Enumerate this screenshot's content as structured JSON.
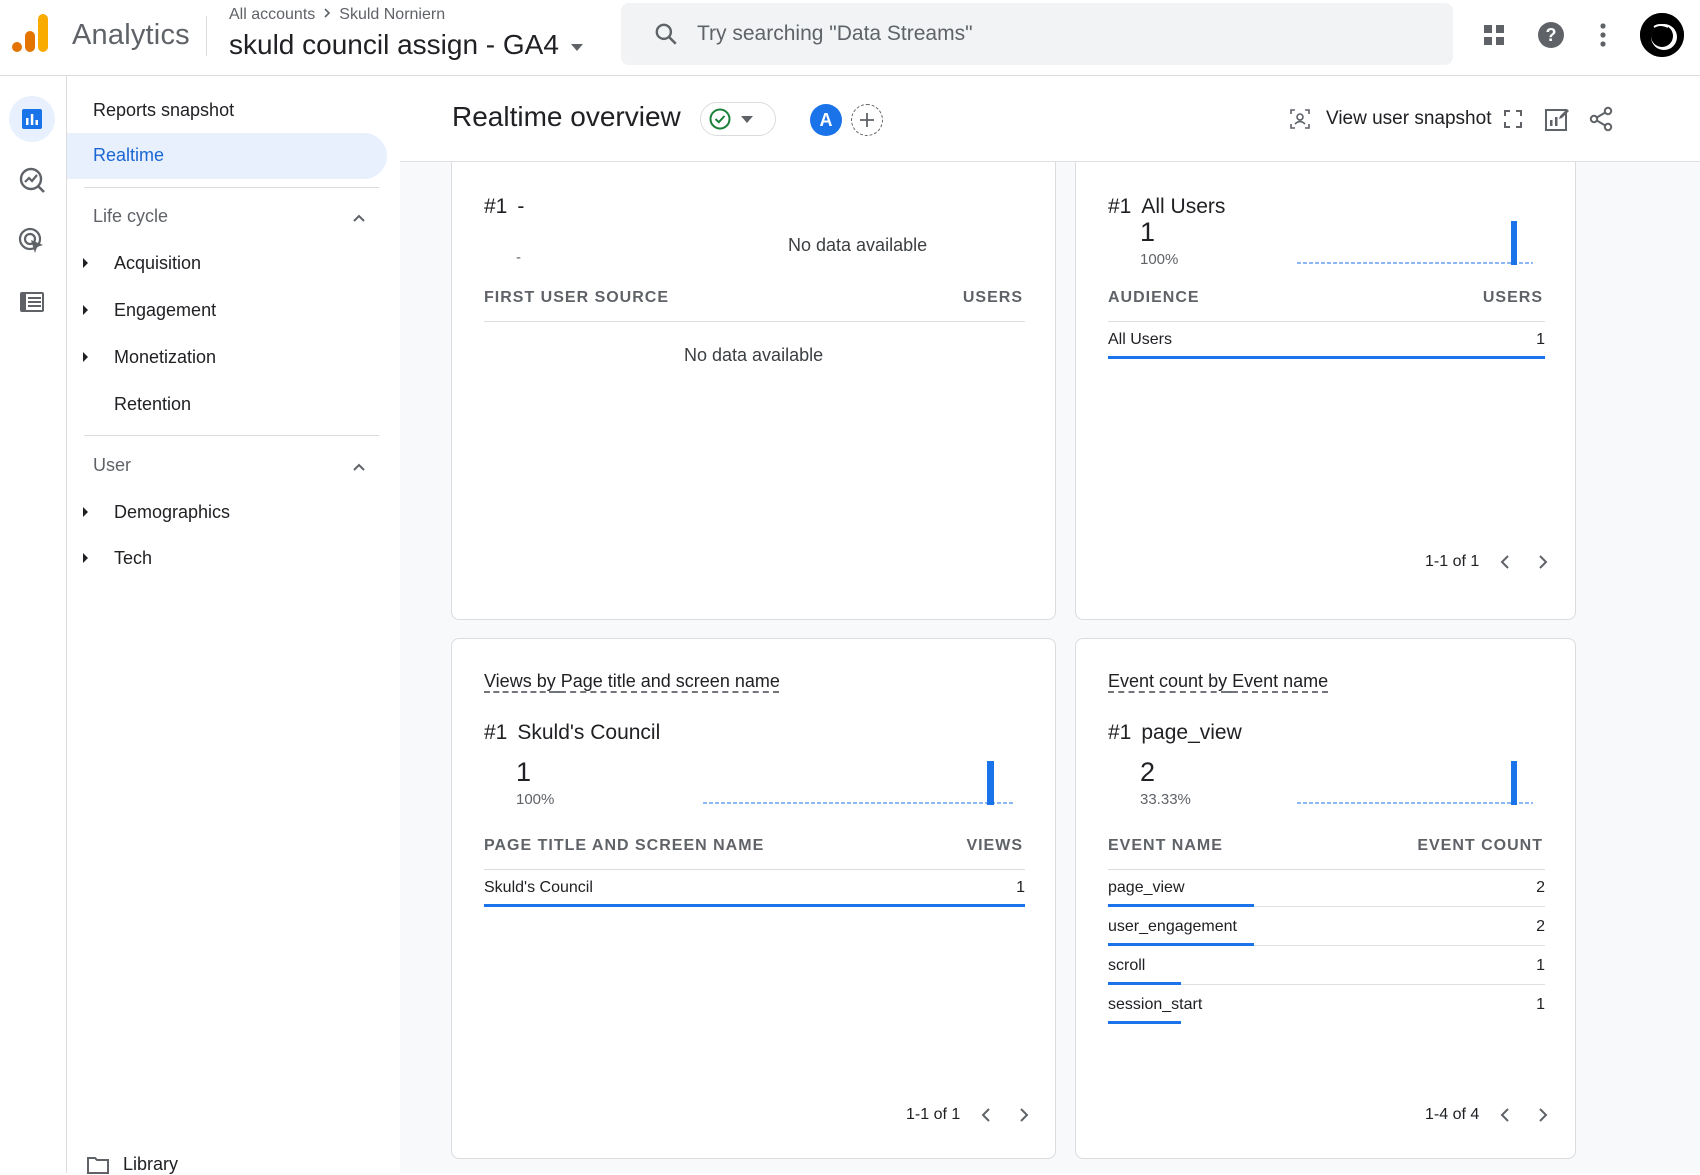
{
  "topbar": {
    "product_name": "Analytics",
    "breadcrumb": [
      "All accounts",
      "Skuld Norniern"
    ],
    "property_title": "skuld council assign - GA4",
    "search_placeholder": "Try searching \"Data Streams\""
  },
  "nav": {
    "reports_snapshot": "Reports snapshot",
    "realtime": "Realtime",
    "lifecycle": {
      "label": "Life cycle",
      "items": [
        "Acquisition",
        "Engagement",
        "Monetization",
        "Retention"
      ]
    },
    "user": {
      "label": "User",
      "items": [
        "Demographics",
        "Tech"
      ]
    },
    "library": "Library"
  },
  "header": {
    "title": "Realtime overview",
    "comparison_letter": "A",
    "view_user_snapshot": "View user snapshot"
  },
  "cards": {
    "source": {
      "rank_num": "#1",
      "rank_name": "-",
      "value_placeholder": "-",
      "chart_nodata": "No data available",
      "col_name": "FIRST USER SOURCE",
      "col_value": "USERS",
      "table_nodata": "No data available"
    },
    "audience": {
      "rank_num": "#1",
      "rank_name": "All Users",
      "value": "1",
      "pct": "100%",
      "col_name": "AUDIENCE",
      "col_value": "USERS",
      "rows": [
        {
          "name": "All Users",
          "value": "1",
          "share": 1.0
        }
      ],
      "pager": "1-1 of 1"
    },
    "views": {
      "title_prefix": "Views by",
      "title_dim": "Page title and screen name",
      "rank_num": "#1",
      "rank_name": "Skuld's Council",
      "value": "1",
      "pct": "100%",
      "col_name": "PAGE TITLE AND SCREEN NAME",
      "col_value": "VIEWS",
      "rows": [
        {
          "name": "Skuld's Council",
          "value": "1",
          "share": 1.0
        }
      ],
      "pager": "1-1 of 1"
    },
    "events": {
      "title_prefix": "Event count by",
      "title_dim": "Event name",
      "rank_num": "#1",
      "rank_name": "page_view",
      "value": "2",
      "pct": "33.33%",
      "col_name": "EVENT NAME",
      "col_value": "EVENT COUNT",
      "rows": [
        {
          "name": "page_view",
          "value": "2",
          "share": 0.333
        },
        {
          "name": "user_engagement",
          "value": "2",
          "share": 0.333
        },
        {
          "name": "scroll",
          "value": "1",
          "share": 0.167
        },
        {
          "name": "session_start",
          "value": "1",
          "share": 0.167
        }
      ],
      "pager": "1-4 of 4"
    }
  },
  "colors": {
    "accent": "#1a73e8",
    "nav_active_bg": "#e8f0fe",
    "nav_active_text": "#1967d2",
    "status_ok": "#188038",
    "logo_orange": "#f9ab00",
    "logo_dark_orange": "#e37400"
  }
}
